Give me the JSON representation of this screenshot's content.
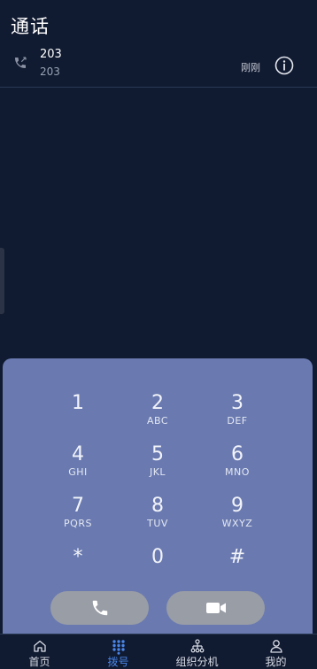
{
  "header": {
    "title": "通话"
  },
  "call_log": [
    {
      "name": "203",
      "number": "203",
      "time": "刚刚"
    }
  ],
  "dialpad": {
    "keys": [
      {
        "digit": "1",
        "letters": ""
      },
      {
        "digit": "2",
        "letters": "ABC"
      },
      {
        "digit": "3",
        "letters": "DEF"
      },
      {
        "digit": "4",
        "letters": "GHI"
      },
      {
        "digit": "5",
        "letters": "JKL"
      },
      {
        "digit": "6",
        "letters": "MNO"
      },
      {
        "digit": "7",
        "letters": "PQRS"
      },
      {
        "digit": "8",
        "letters": "TUV"
      },
      {
        "digit": "9",
        "letters": "WXYZ"
      },
      {
        "digit": "*",
        "letters": ""
      },
      {
        "digit": "0",
        "letters": ""
      },
      {
        "digit": "#",
        "letters": ""
      }
    ],
    "voice_call_icon": "phone-icon",
    "video_call_icon": "video-camera-icon"
  },
  "bottom_nav": {
    "items": [
      {
        "label": "首页",
        "icon": "home-icon",
        "active": false
      },
      {
        "label": "拨号",
        "icon": "dialpad-icon",
        "active": true
      },
      {
        "label": "组织分机",
        "icon": "org-tree-icon",
        "active": false
      },
      {
        "label": "我的",
        "icon": "person-icon",
        "active": false
      }
    ]
  },
  "colors": {
    "background": "#101a30",
    "dialpad_panel": "#6a7ab0",
    "action_button": "#999da6",
    "active_nav": "#4a86e8"
  }
}
